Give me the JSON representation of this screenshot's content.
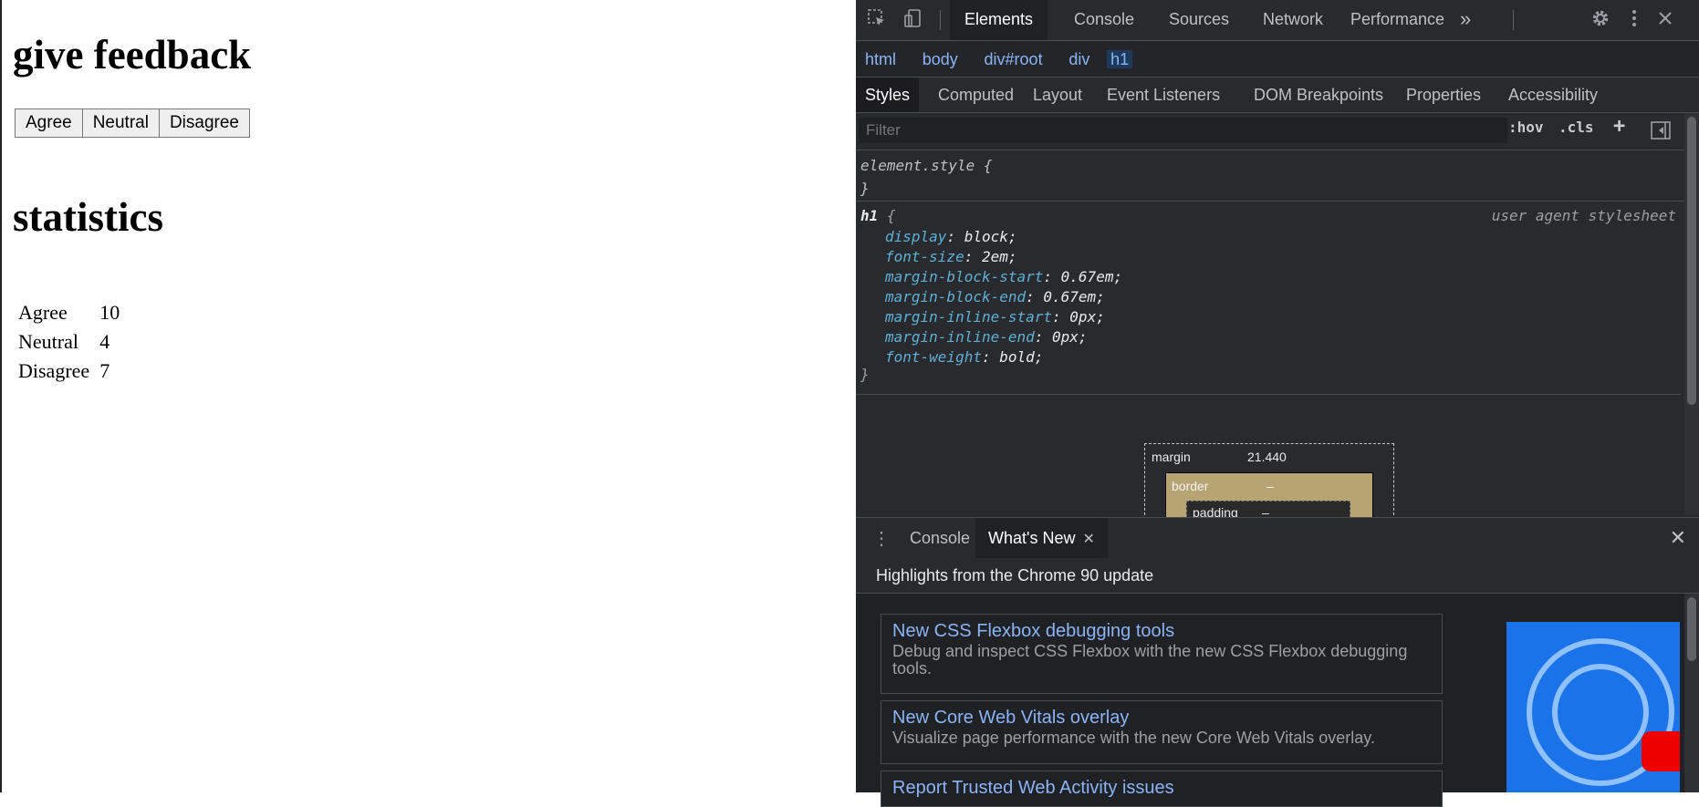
{
  "page": {
    "feedback_heading": "give feedback",
    "buttons": [
      "Agree",
      "Neutral",
      "Disagree"
    ],
    "statistics_heading": "statistics",
    "stats": [
      {
        "label": "Agree",
        "value": "10"
      },
      {
        "label": "Neutral",
        "value": "4"
      },
      {
        "label": "Disagree",
        "value": "7"
      }
    ]
  },
  "devtools": {
    "main_tabs": [
      "Elements",
      "Console",
      "Sources",
      "Network",
      "Performance"
    ],
    "more_tabs": "»",
    "breadcrumbs": [
      "html",
      "body",
      "div#root",
      "div",
      "h1"
    ],
    "sub_tabs": [
      "Styles",
      "Computed",
      "Layout",
      "Event Listeners",
      "DOM Breakpoints",
      "Properties",
      "Accessibility"
    ],
    "filter_placeholder": "Filter",
    "hov": ":hov",
    "cls": ".cls",
    "plus": "+",
    "element_style_open": "element.style {",
    "element_style_close": "}",
    "h1_selector": "h1",
    "h1_brace": "{",
    "h1_origin": "user agent stylesheet",
    "h1_declarations": [
      {
        "prop": "display",
        "value": "block;"
      },
      {
        "prop": "font-size",
        "value": "2em;"
      },
      {
        "prop": "margin-block-start",
        "value": "0.67em;"
      },
      {
        "prop": "margin-block-end",
        "value": "0.67em;"
      },
      {
        "prop": "margin-inline-start",
        "value": "0px;"
      },
      {
        "prop": "margin-inline-end",
        "value": "0px;"
      },
      {
        "prop": "font-weight",
        "value": "bold;"
      }
    ],
    "h1_close": "}",
    "box_model": {
      "margin_label": "margin",
      "margin_value": "21.440",
      "border_label": "border",
      "border_value": "–",
      "padding_label": "padding",
      "padding_value": "–"
    },
    "drawer_tabs": [
      "Console",
      "What's New"
    ],
    "whats_new_heading": "Highlights from the Chrome 90 update",
    "cards": [
      {
        "title": "New CSS Flexbox debugging tools",
        "desc": "Debug and inspect CSS Flexbox with the new CSS Flexbox debugging tools."
      },
      {
        "title": "New Core Web Vitals overlay",
        "desc": "Visualize page performance with the new Core Web Vitals overlay."
      },
      {
        "title": "Report Trusted Web Activity issues",
        "desc": ""
      }
    ]
  },
  "colors": {
    "devtools_bg": "#292a2d",
    "accent_blue": "#8ab4f8",
    "css_prop": "#5db0d7"
  }
}
